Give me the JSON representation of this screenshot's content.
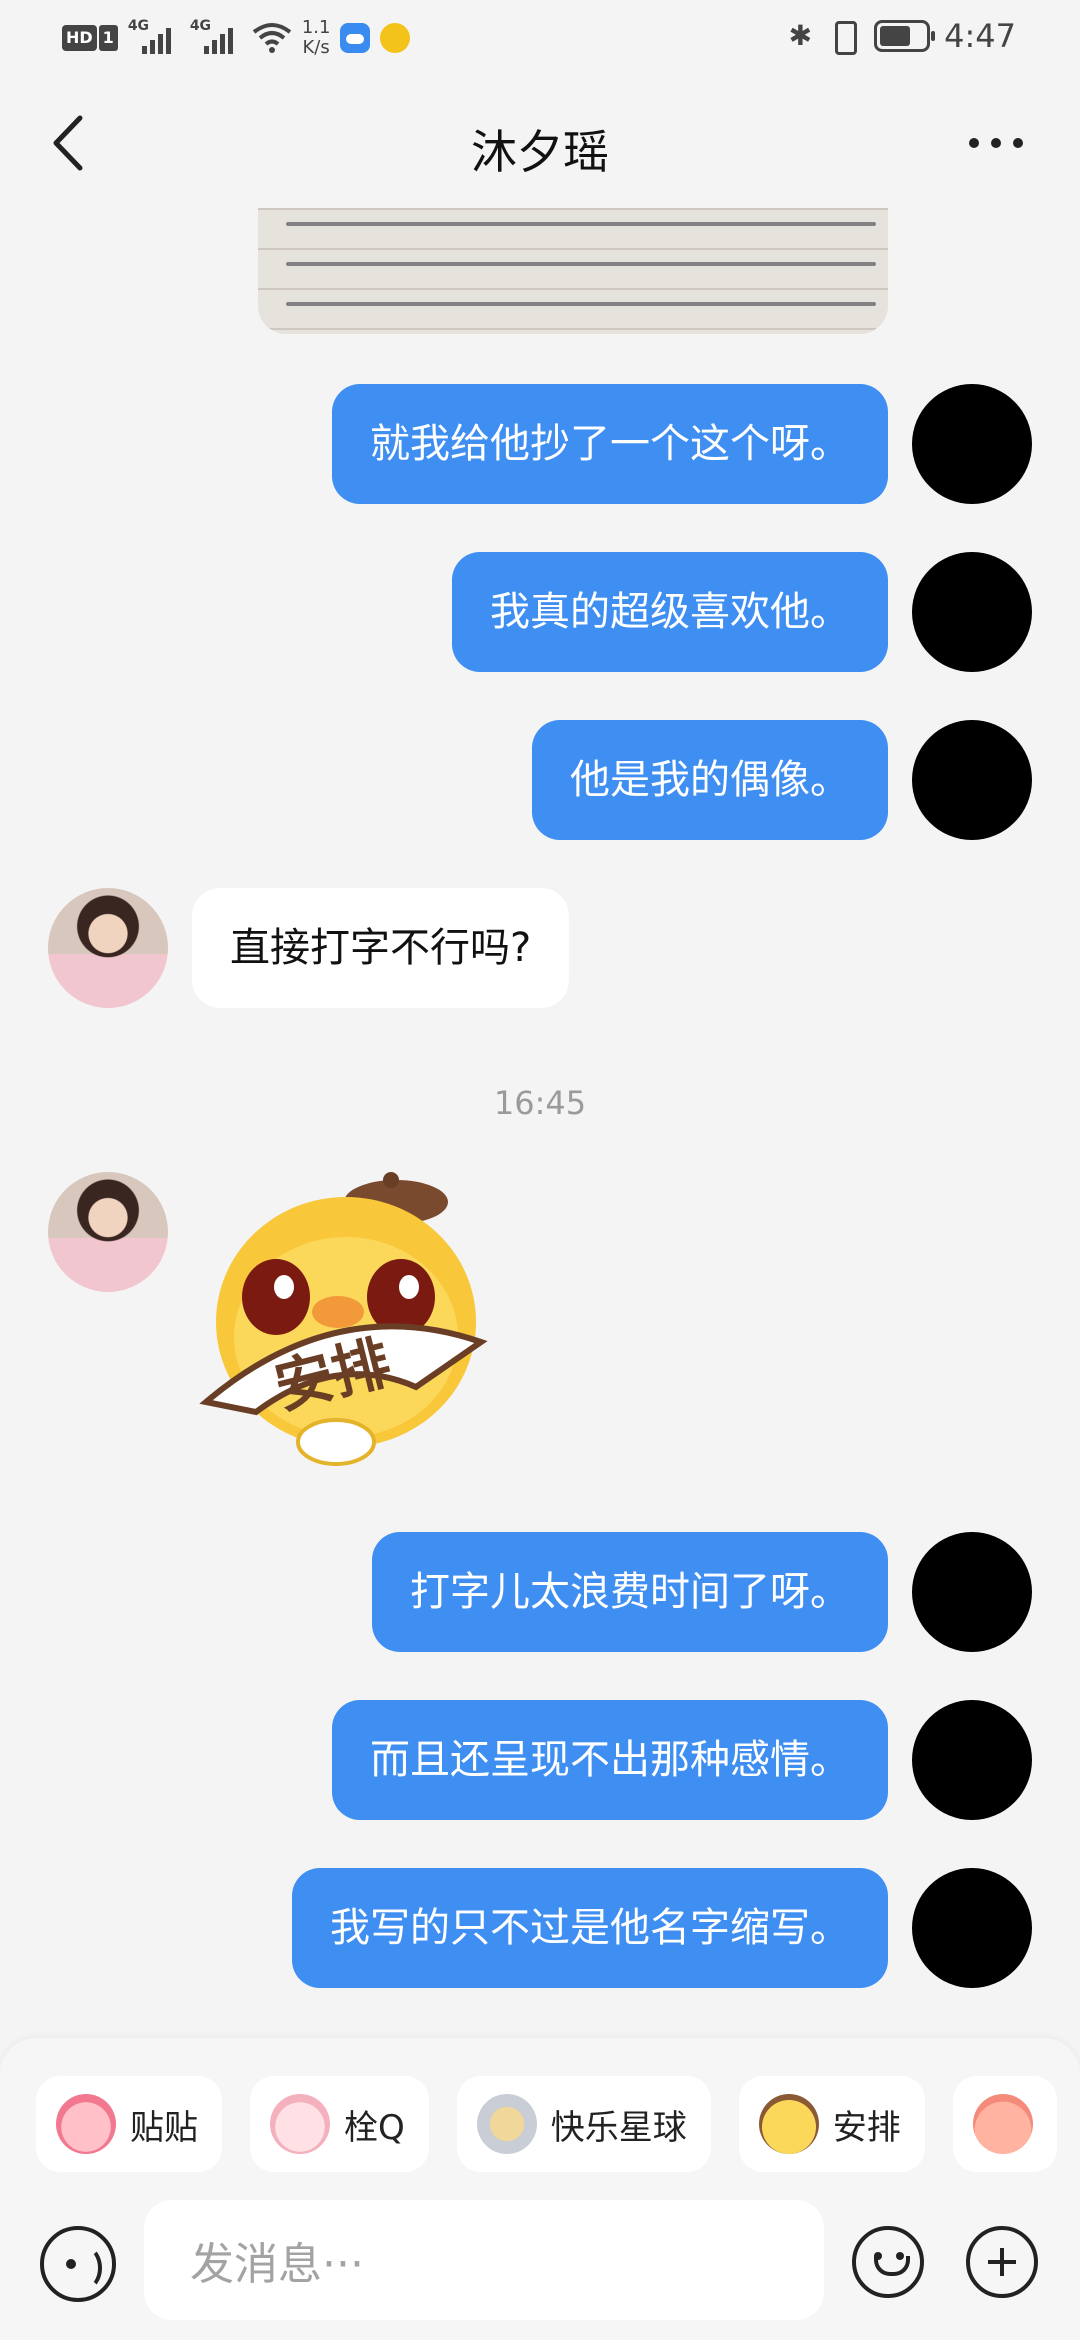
{
  "status_bar": {
    "hd_label": "HD",
    "sim_label": "1",
    "network_1": "4G",
    "network_2": "4G",
    "speed_value": "1.1",
    "speed_unit": "K/s",
    "bluetooth_icon": "bluetooth-icon",
    "vibrate_icon": "vibrate-icon",
    "battery_icon": "battery-icon",
    "time": "4:47"
  },
  "header": {
    "back_icon": "chevron-left-icon",
    "title": "沐夕瑶",
    "more_icon": "more-dots-icon"
  },
  "messages": {
    "out_1": "就我给他抄了一个这个呀。",
    "out_2": "我真的超级喜欢他。",
    "out_3": "他是我的偶像。",
    "in_1": "直接打字不行吗?",
    "timestamp": "16:45",
    "sticker_text": "安排",
    "out_4": "打字儿太浪费时间了呀。",
    "out_5": "而且还呈现不出那种感情。",
    "out_6": "我写的只不过是他名字缩写。"
  },
  "quick_chips": [
    {
      "label": "贴贴",
      "icon": "blush-sticker-icon"
    },
    {
      "label": "栓Q",
      "icon": "pig-sticker-icon"
    },
    {
      "label": "快乐星球",
      "icon": "astronaut-sticker-icon"
    },
    {
      "label": "安排",
      "icon": "duck-sticker-icon"
    },
    {
      "label": "",
      "icon": "peach-sticker-icon"
    }
  ],
  "composer": {
    "placeholder": "发消息···",
    "voice_icon": "voice-icon",
    "emoji_icon": "emoji-icon",
    "plus_icon": "plus-icon"
  },
  "colors": {
    "outgoing_bubble": "#3f8ef1",
    "incoming_bubble": "#ffffff",
    "background": "#f4f4f5"
  }
}
